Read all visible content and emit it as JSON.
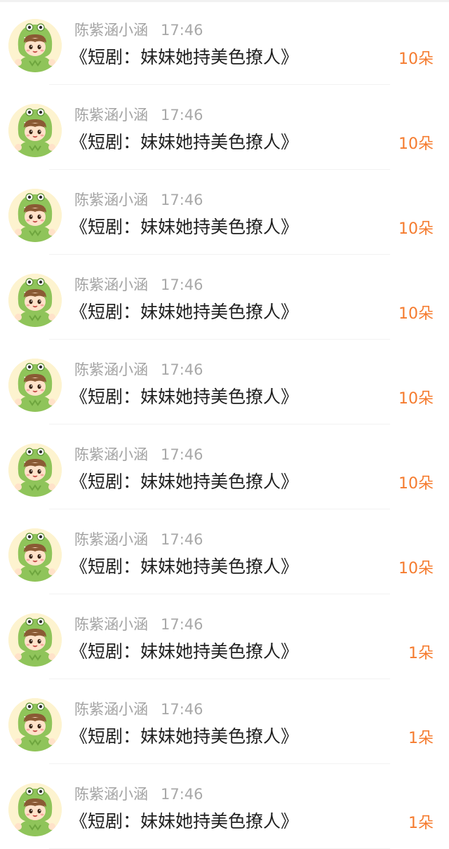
{
  "messages": [
    {
      "user": "陈紫涵小涵",
      "time": "17:46",
      "text": "《短剧：妹妹她持美色撩人》",
      "gift": "10朵"
    },
    {
      "user": "陈紫涵小涵",
      "time": "17:46",
      "text": "《短剧：妹妹她持美色撩人》",
      "gift": "10朵"
    },
    {
      "user": "陈紫涵小涵",
      "time": "17:46",
      "text": "《短剧：妹妹她持美色撩人》",
      "gift": "10朵"
    },
    {
      "user": "陈紫涵小涵",
      "time": "17:46",
      "text": "《短剧：妹妹她持美色撩人》",
      "gift": "10朵"
    },
    {
      "user": "陈紫涵小涵",
      "time": "17:46",
      "text": "《短剧：妹妹她持美色撩人》",
      "gift": "10朵"
    },
    {
      "user": "陈紫涵小涵",
      "time": "17:46",
      "text": "《短剧：妹妹她持美色撩人》",
      "gift": "10朵"
    },
    {
      "user": "陈紫涵小涵",
      "time": "17:46",
      "text": "《短剧：妹妹她持美色撩人》",
      "gift": "10朵"
    },
    {
      "user": "陈紫涵小涵",
      "time": "17:46",
      "text": "《短剧：妹妹她持美色撩人》",
      "gift": "1朵"
    },
    {
      "user": "陈紫涵小涵",
      "time": "17:46",
      "text": "《短剧：妹妹她持美色撩人》",
      "gift": "1朵"
    },
    {
      "user": "陈紫涵小涵",
      "time": "17:46",
      "text": "《短剧：妹妹她持美色撩人》",
      "gift": "1朵"
    }
  ],
  "avatar_icon": "dinosaur-costume-avatar",
  "colors": {
    "gift": "#f57b2e",
    "username": "#a3a3a3",
    "message": "#1f1f1f",
    "divider": "#f2f2f2"
  }
}
